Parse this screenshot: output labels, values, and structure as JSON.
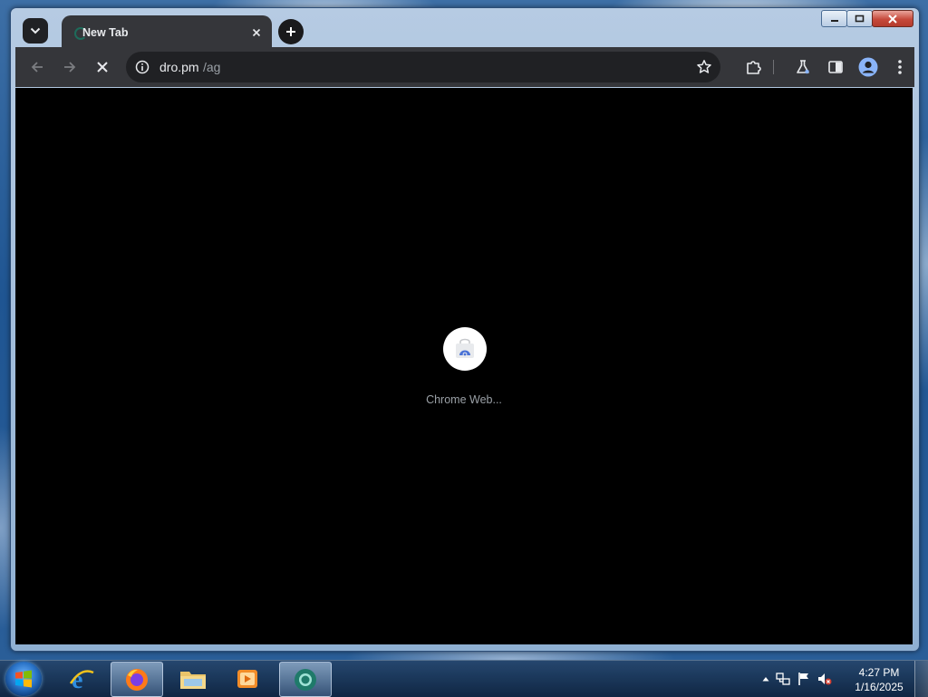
{
  "browser": {
    "tab": {
      "title": "New Tab",
      "close_label": "×"
    },
    "new_tab_label": "+",
    "omnibox": {
      "host": "dro.pm",
      "path": "/ag"
    }
  },
  "content": {
    "loader_text": "Chrome Web..."
  },
  "taskbar": {
    "apps": [
      {
        "name": "internet-explorer",
        "icon": "ie-icon"
      },
      {
        "name": "firefox",
        "icon": "firefox-icon"
      },
      {
        "name": "file-explorer",
        "icon": "folder-icon"
      },
      {
        "name": "media-player",
        "icon": "media-player-icon"
      },
      {
        "name": "chrome-active",
        "icon": "chrome-icon",
        "active": true
      }
    ],
    "clock": {
      "time": "4:27 PM",
      "date": "1/16/2025"
    }
  },
  "colors": {
    "tab_active": "#35363a",
    "toolbar": "#35363a",
    "omnibox": "#202124",
    "page_background": "#000000",
    "taskbar": "#1a3a63"
  }
}
